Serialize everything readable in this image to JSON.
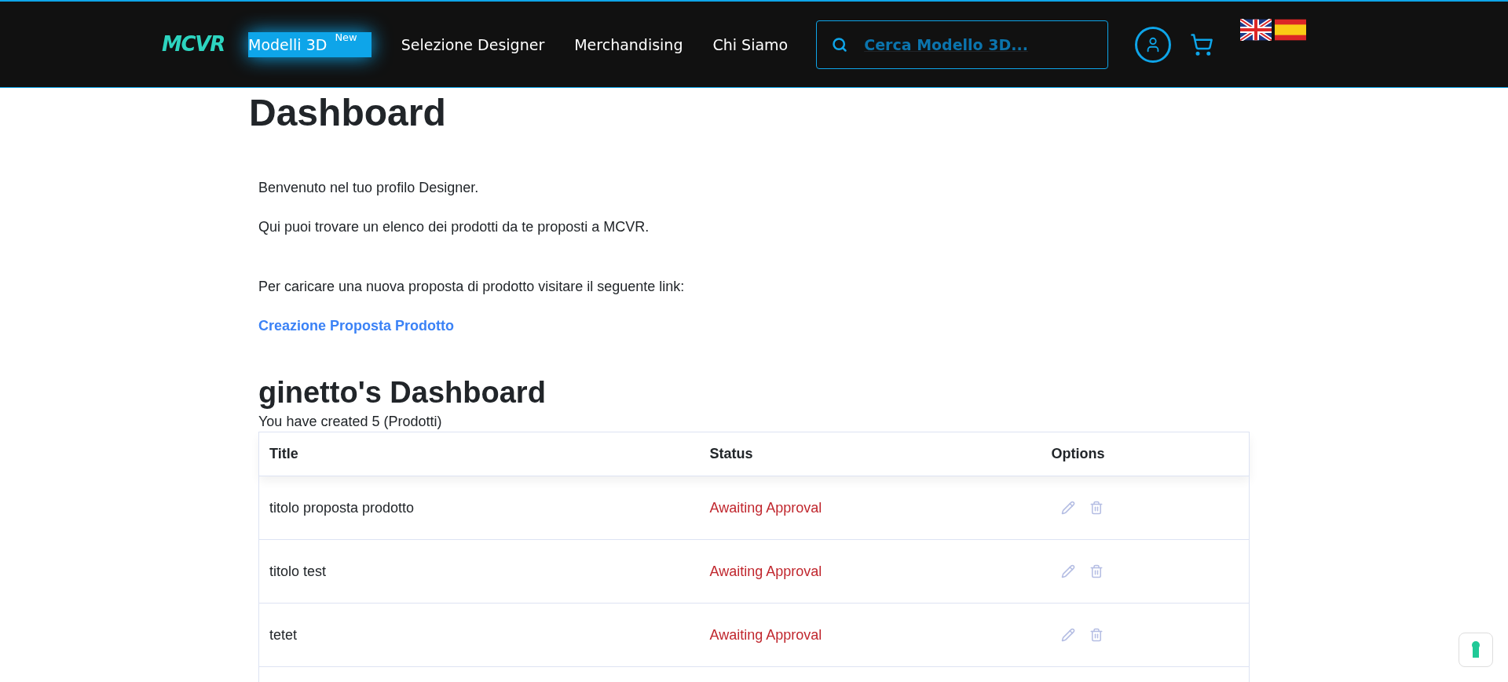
{
  "header": {
    "logo": "MCVR",
    "nav": [
      {
        "label": "Modelli 3D",
        "badge": "New",
        "selected": true
      },
      {
        "label": "Selezione Designer",
        "selected": false
      },
      {
        "label": "Merchandising",
        "selected": false
      },
      {
        "label": "Chi Siamo",
        "selected": false
      }
    ],
    "search": {
      "placeholder": "Cerca Modello 3D..."
    }
  },
  "page": {
    "title": "Dashboard",
    "paragraphs": [
      "Benvenuto nel tuo profilo Designer.",
      "Qui puoi trovare un elenco dei prodotti da te proposti a MCVR.",
      "Per caricare una nuova proposta di prodotto visitare il seguente link:"
    ],
    "link": "Creazione Proposta Prodotto"
  },
  "dashboard": {
    "title": "ginetto's Dashboard",
    "summary": "You have created 5 (Prodotti)",
    "columns": [
      "Title",
      "Status",
      "Options"
    ],
    "rows": [
      {
        "title": "titolo proposta prodotto",
        "status": "Awaiting Approval"
      },
      {
        "title": "titolo test",
        "status": "Awaiting Approval"
      },
      {
        "title": "tetet",
        "status": "Awaiting Approval"
      }
    ]
  }
}
